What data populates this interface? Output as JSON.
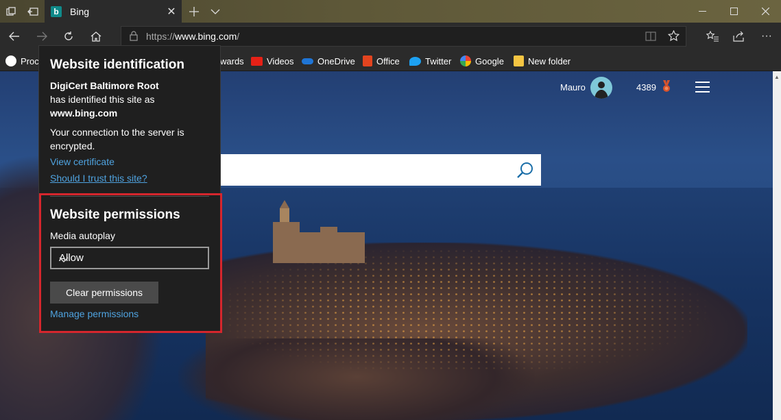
{
  "tab": {
    "title": "Bing",
    "favicon_letter": "b"
  },
  "address_bar": {
    "url_prefix": "https://",
    "url_host": "www.bing.com",
    "url_suffix": "/"
  },
  "favorites": [
    {
      "label": "Proc",
      "icon": "dell-icon"
    },
    {
      "label": "wards",
      "icon": "rewards-icon"
    },
    {
      "label": "Videos",
      "icon": "youtube-icon"
    },
    {
      "label": "OneDrive",
      "icon": "onedrive-icon"
    },
    {
      "label": "Office",
      "icon": "office-icon"
    },
    {
      "label": "Twitter",
      "icon": "twitter-icon"
    },
    {
      "label": "Google",
      "icon": "google-icon"
    },
    {
      "label": "New folder",
      "icon": "folder-icon"
    }
  ],
  "bing": {
    "user_name": "Mauro",
    "points": "4389"
  },
  "popup": {
    "identification_title": "Website identification",
    "issuer": "DigiCert Baltimore Root",
    "identified_text": "has identified this site as",
    "site": "www.bing.com",
    "connection_line1": "Your connection to the server is",
    "connection_line2": "encrypted.",
    "view_certificate": "View certificate",
    "trust_link": "Should I trust this site?",
    "permissions_title": "Website permissions",
    "media_autoplay_label": "Media autoplay",
    "media_autoplay_value": "Allow",
    "clear_permissions": "Clear permissions",
    "manage_permissions": "Manage permissions"
  },
  "colors": {
    "highlight": "#d6262d",
    "link": "#4fa3e0",
    "chrome_dark": "#2b2b2b"
  }
}
